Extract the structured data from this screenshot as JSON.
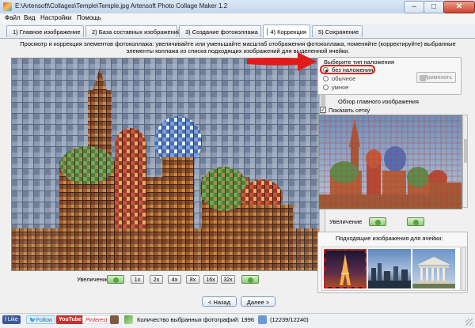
{
  "window": {
    "title": "E:\\Artensoft\\Collages\\Temple\\Temple.jpg Artensoft Photo Collage Maker 1.2",
    "minimize": "–",
    "maximize": "□",
    "close": "✕"
  },
  "menu": [
    "Файл",
    "Вид",
    "Настройки",
    "Помощь"
  ],
  "tabs": [
    {
      "label": "1) Главное изображение",
      "icon": "photo-icon",
      "color": "#4a90d9"
    },
    {
      "label": "2) База составных изображений",
      "icon": "database-icon",
      "color": "#2f6fb3"
    },
    {
      "label": "3) Создание фотоколлажа",
      "icon": "wand-icon",
      "color": "#d9a521"
    },
    {
      "label": "4) Коррекция",
      "icon": "correction-icon",
      "color": "#3d8ee0"
    },
    {
      "label": "5) Сохранение",
      "icon": "save-icon",
      "color": "#3a6ea5"
    }
  ],
  "active_tab": 3,
  "description": "Просмотр и коррекция элементов фотоколлажа: увеличивайте или уменьшайте масштаб отображения фотоколлажа, поменяйте (корректируйте) выбранные элементы коллажа из списка подходящих изображений для выделенной ячейки.",
  "zoom": {
    "label": "Увеличение:",
    "levels": [
      "1x",
      "2x",
      "4x",
      "8x",
      "16x",
      "32x"
    ]
  },
  "nav": {
    "back": "< Назад",
    "next": "Далее >"
  },
  "overlay": {
    "title": "Выберите тип наложения",
    "options": [
      "без наложения",
      "обычное",
      "умное"
    ],
    "selected": 0,
    "apply": "Применить"
  },
  "overview": {
    "title": "Обзор главного изображения",
    "show_grid": "Показать сетку",
    "show_grid_checked": true,
    "zoom_label": "Увеличение"
  },
  "suggestions": {
    "title": "Подходящие изображения для ячейки:",
    "selected_index": 0
  },
  "status": {
    "social": [
      "Like",
      "Follow",
      "YouTube",
      "Pinterest"
    ],
    "selected_photos": "Количество выбранных фотографий: 1996",
    "count": "(12239/12240)"
  },
  "colors": {
    "accent": "#3d8ee0",
    "highlight_red": "#e11b1b",
    "sky": "#7f92ad"
  }
}
